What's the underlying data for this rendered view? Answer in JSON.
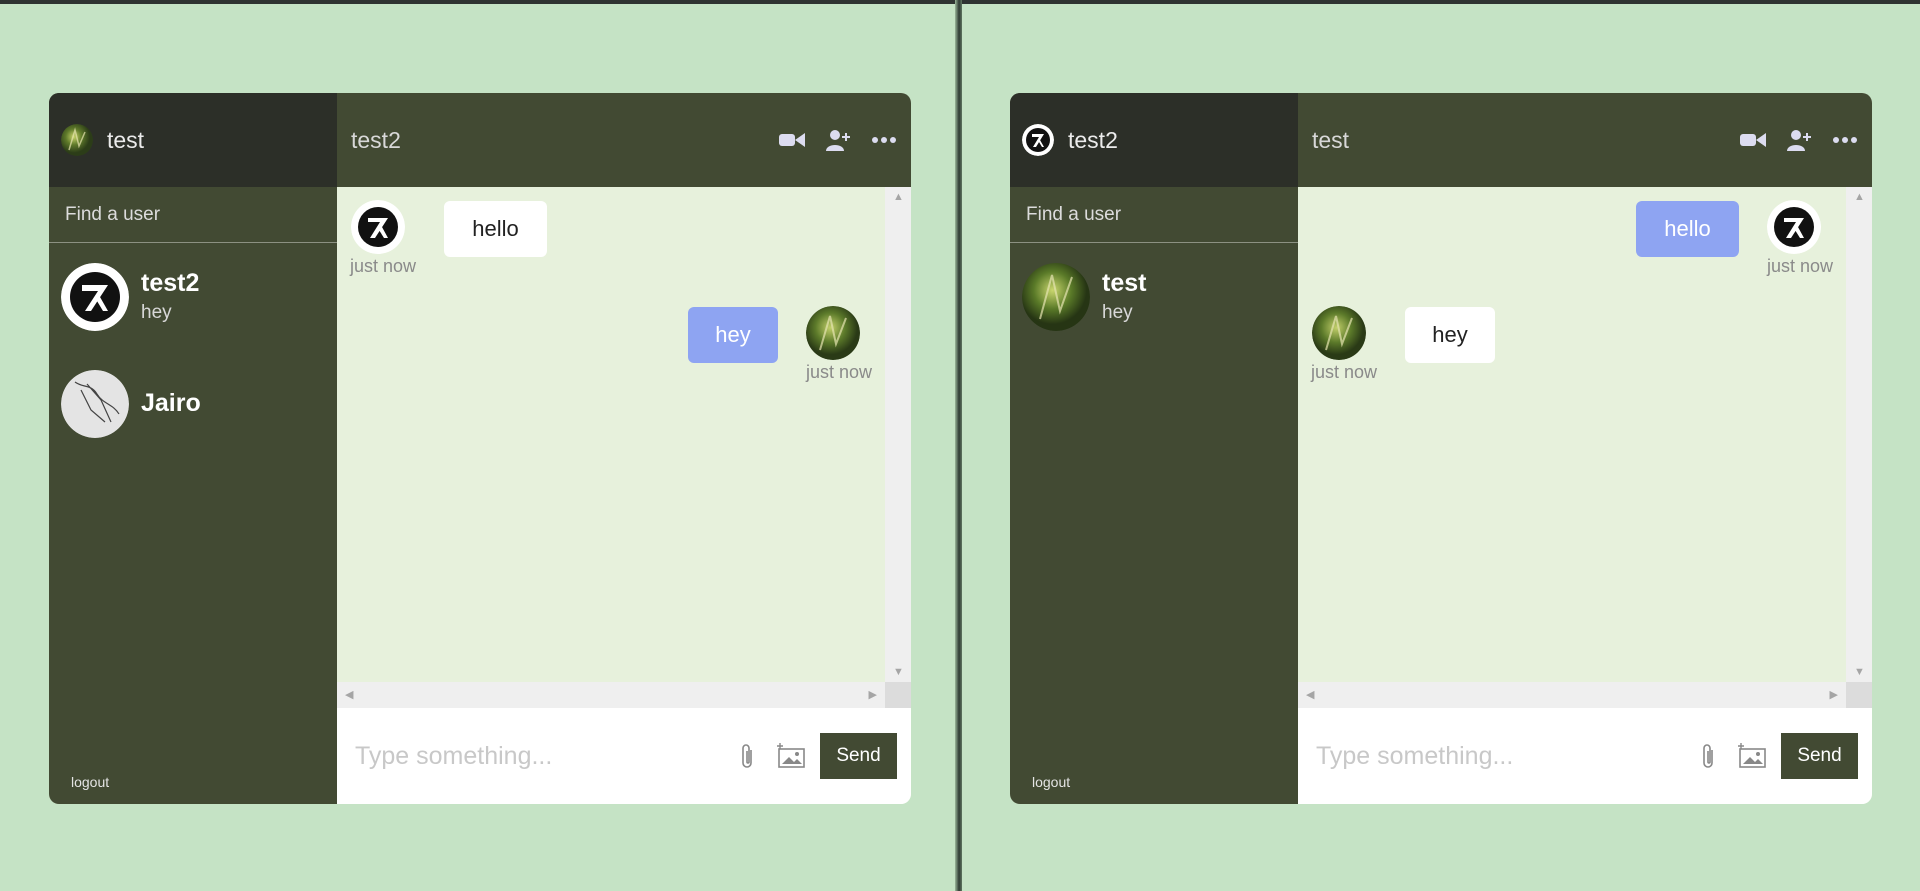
{
  "panes": [
    {
      "me": {
        "name": "test",
        "avatar": "nature-avatar"
      },
      "search_placeholder": "Find a user",
      "users": [
        {
          "name": "test2",
          "last_message": "hey",
          "avatar": "aphex-logo-avatar"
        },
        {
          "name": "Jairo",
          "last_message": "",
          "avatar": "sketch-avatar"
        }
      ],
      "logout_label": "logout",
      "chat_name": "test2",
      "messages": [
        {
          "text": "hello",
          "time": "just now",
          "direction": "incoming",
          "avatar": "aphex-logo-avatar"
        },
        {
          "text": "hey",
          "time": "just now",
          "direction": "outgoing",
          "avatar": "nature-avatar"
        }
      ],
      "input_placeholder": "Type something...",
      "send_label": "Send"
    },
    {
      "me": {
        "name": "test2",
        "avatar": "aphex-logo-avatar"
      },
      "search_placeholder": "Find a user",
      "users": [
        {
          "name": "test",
          "last_message": "hey",
          "avatar": "nature-avatar"
        }
      ],
      "logout_label": "logout",
      "chat_name": "test",
      "messages": [
        {
          "text": "hello",
          "time": "just now",
          "direction": "outgoing",
          "avatar": "aphex-logo-avatar"
        },
        {
          "text": "hey",
          "time": "just now",
          "direction": "incoming",
          "avatar": "nature-avatar"
        }
      ],
      "input_placeholder": "Type something...",
      "send_label": "Send"
    }
  ],
  "colors": {
    "background": "#c5e3c5",
    "sidebar": "#424a33",
    "sidebar_header": "#2c2f28",
    "chat_area": "#e7f1dc",
    "outgoing_bubble": "#8ea4f2",
    "incoming_bubble": "#ffffff"
  }
}
